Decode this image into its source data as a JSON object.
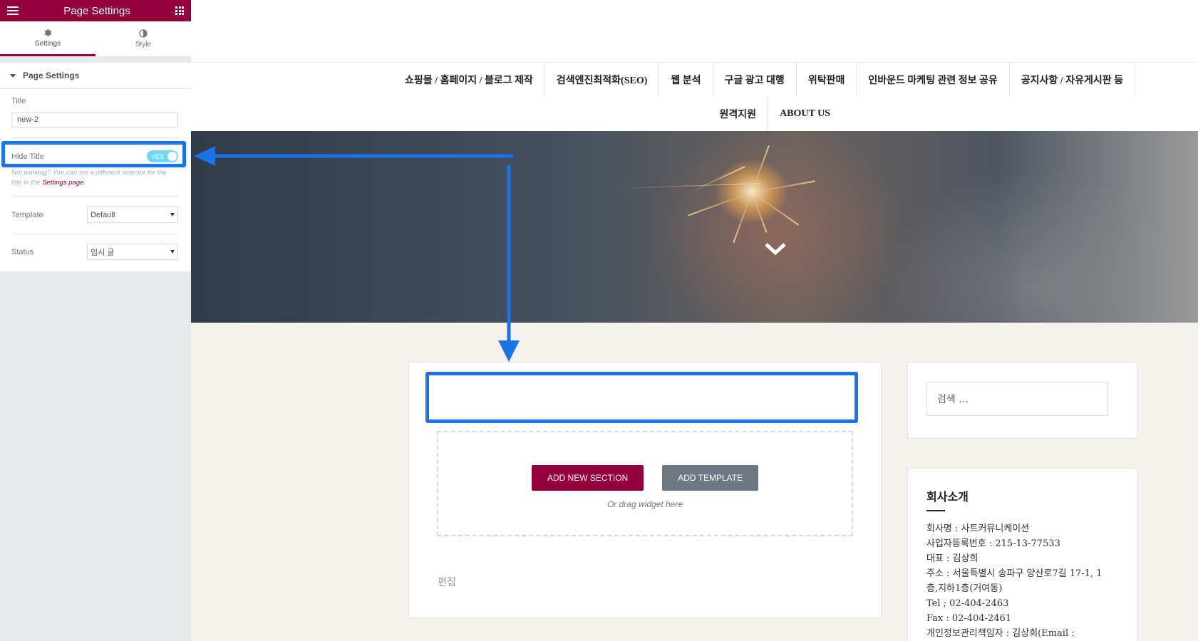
{
  "panel": {
    "header_title": "Page Settings",
    "tabs": [
      {
        "label": "Settings"
      },
      {
        "label": "Style"
      }
    ],
    "section_title": "Page Settings",
    "title_label": "Title",
    "title_value": "new-2",
    "hide_title_label": "Hide Title",
    "hide_title_toggle": "YES",
    "hint_text": "Not working? You can set a different selector for the title in the ",
    "hint_link": "Settings page",
    "template_label": "Template",
    "template_value": "Default",
    "status_label": "Status",
    "status_value": "임시 글"
  },
  "nav": {
    "row1": [
      "쇼핑몰 / 홈페이지 / 블로그 제작",
      "검색엔진최적화(SEO)",
      "웹 분석",
      "구글 광고 대행",
      "위탁판매",
      "인바운드 마케팅 관련 정보 공유",
      "공지사항 / 자유게시판 등"
    ],
    "row2": [
      "원격지원",
      "ABOUT US"
    ]
  },
  "editor": {
    "add_section_label": "ADD NEW SECTION",
    "add_template_label": "ADD TEMPLATE",
    "drag_text": "Or drag widget here",
    "edit_link": "편집"
  },
  "sidebar": {
    "search_placeholder": "검색 …",
    "about_title": "회사소개",
    "about_lines": [
      "회사명 : 사트커뮤니케이션",
      "사업자등록번호 : 215-13-77533",
      "대표 : 김상희",
      "주소 : 서울특별시 송파구 양산로7길 17-1, 1",
      "층,지하1층(거여동)",
      "Tel ; 02-404-2463",
      "Fax : 02-404-2461",
      "개인정보관리책임자 : 김상희(Email :"
    ]
  },
  "colors": {
    "elementor_accent": "#93003c",
    "highlight_blue": "#1a73e8",
    "toggle_on": "#71d7f7"
  }
}
